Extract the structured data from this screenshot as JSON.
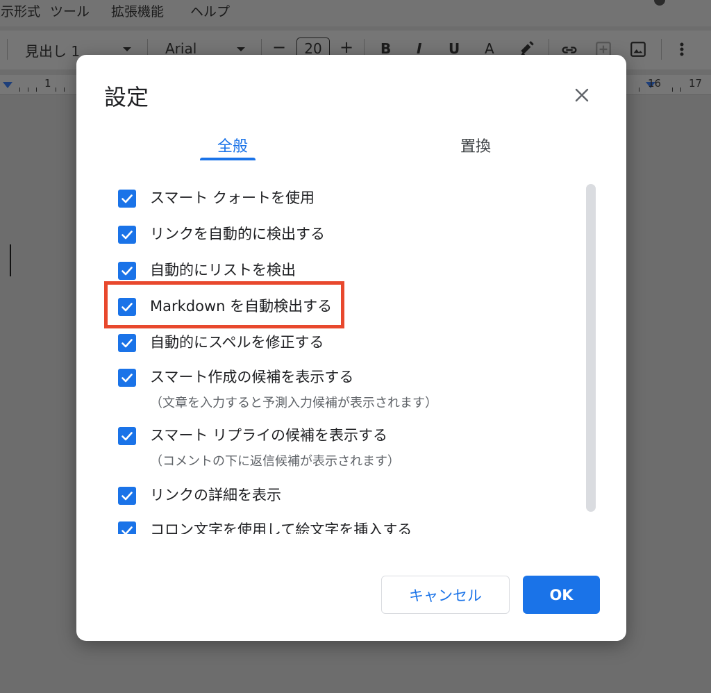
{
  "menu": [
    "表示形式",
    "ツール",
    "拡張機能",
    "ヘルプ"
  ],
  "toolbar": {
    "style_value": "見出し 1",
    "font_value": "Arial",
    "font_size": "20",
    "minus": "−",
    "plus": "+",
    "bold": "B",
    "italic": "I",
    "underline": "U",
    "text_color": "A"
  },
  "ruler": {
    "left_number": "1",
    "right_numbers": [
      "16",
      "17"
    ]
  },
  "dialog": {
    "title": "設定",
    "tabs": [
      {
        "label": "全般",
        "active": true
      },
      {
        "label": "置換",
        "active": false
      }
    ],
    "options": [
      {
        "label": "スマート クォートを使用",
        "checked": true
      },
      {
        "label": "リンクを自動的に検出する",
        "checked": true
      },
      {
        "label": "自動的にリストを検出",
        "checked": true
      },
      {
        "label": "Markdown を自動検出する",
        "checked": true,
        "highlighted": true
      },
      {
        "label": "自動的にスペルを修正する",
        "checked": true
      },
      {
        "label": "スマート作成の候補を表示する",
        "sub": "（文章を入力すると予測入力候補が表示されます）",
        "checked": true
      },
      {
        "label": "スマート リプライの候補を表示する",
        "sub": "（コメントの下に返信候補が表示されます）",
        "checked": true
      },
      {
        "label": "リンクの詳細を表示",
        "checked": true
      },
      {
        "label": "コロン文字を使用して絵文字を挿入する",
        "checked": true
      }
    ],
    "cancel_label": "キャンセル",
    "ok_label": "OK"
  },
  "colors": {
    "accent": "#1a73e8",
    "highlight_border": "#e8482d",
    "overlay": "#6d6d6d"
  },
  "icons": [
    "close-icon",
    "checkmark-icon",
    "link-icon",
    "insert-image-icon",
    "highlighter-icon",
    "more-vert-icon"
  ]
}
